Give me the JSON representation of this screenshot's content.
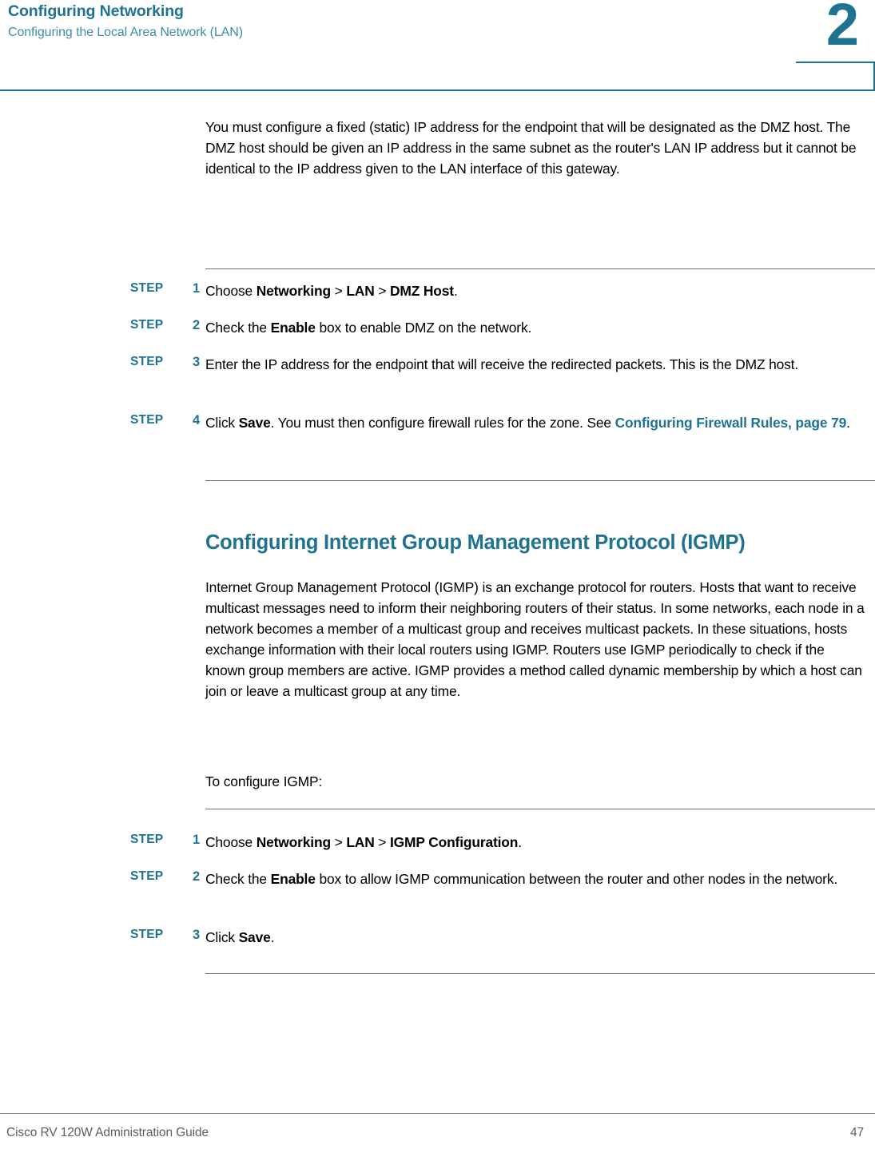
{
  "header": {
    "title": "Configuring Networking",
    "subtitle": "Configuring the Local Area Network (LAN)",
    "chapter_number": "2",
    "rule_color": "#1f7391"
  },
  "colors": {
    "accent_teal": "#1f7391",
    "subtitle_teal": "#3d8fa8",
    "body_black": "#000000",
    "rule_gray": "#6e6e6e",
    "footer_gray": "#5e5e5e"
  },
  "intro_paragraph": "You must configure a fixed (static) IP address for the endpoint that will be designated as the DMZ host. The DMZ host should be given an IP address in the same subnet as the router's LAN IP address but it cannot be identical to the IP address given to the LAN interface of this gateway.",
  "dmz_steps": {
    "label_text": "STEP",
    "items": [
      {
        "number": "1",
        "parts": [
          {
            "text": "Choose ",
            "style": "normal"
          },
          {
            "text": "Networking",
            "style": "bold"
          },
          {
            "text": " > ",
            "style": "normal"
          },
          {
            "text": "LAN",
            "style": "bold"
          },
          {
            "text": " > ",
            "style": "normal"
          },
          {
            "text": "DMZ Host",
            "style": "bold"
          },
          {
            "text": ".",
            "style": "normal"
          }
        ]
      },
      {
        "number": "2",
        "parts": [
          {
            "text": "Check the ",
            "style": "normal"
          },
          {
            "text": "Enable",
            "style": "bold"
          },
          {
            "text": " box to enable DMZ on the network.",
            "style": "normal"
          }
        ]
      },
      {
        "number": "3",
        "parts": [
          {
            "text": "Enter the IP address for the endpoint that will receive the redirected packets. This is the DMZ host.",
            "style": "normal"
          }
        ]
      },
      {
        "number": "4",
        "parts": [
          {
            "text": "Click ",
            "style": "normal"
          },
          {
            "text": "Save",
            "style": "bold"
          },
          {
            "text": ". You must then configure firewall rules for the zone. See ",
            "style": "normal"
          },
          {
            "text": "Configuring Firewall Rules, page 79",
            "style": "xref"
          },
          {
            "text": ".",
            "style": "normal"
          }
        ]
      }
    ]
  },
  "igmp_section": {
    "heading": "Configuring Internet Group Management Protocol (IGMP)",
    "paragraph": "Internet Group Management Protocol (IGMP) is an exchange protocol for routers. Hosts that want to receive multicast messages need to inform their neighboring routers of their status. In some networks, each node in a network becomes a member of a multicast group and receives multicast packets. In these situations, hosts exchange information with their local routers using IGMP. Routers use IGMP periodically to check if the known group members are active. IGMP provides a method called dynamic membership by which a host can join or leave a multicast group at any time.",
    "lead_in": "To configure IGMP:"
  },
  "igmp_steps": {
    "label_text": "STEP",
    "items": [
      {
        "number": "1",
        "parts": [
          {
            "text": "Choose ",
            "style": "normal"
          },
          {
            "text": "Networking",
            "style": "bold"
          },
          {
            "text": " > ",
            "style": "normal"
          },
          {
            "text": "LAN",
            "style": "bold"
          },
          {
            "text": " > ",
            "style": "normal"
          },
          {
            "text": "IGMP Configuration",
            "style": "bold"
          },
          {
            "text": ".",
            "style": "normal"
          }
        ]
      },
      {
        "number": "2",
        "parts": [
          {
            "text": "Check the ",
            "style": "normal"
          },
          {
            "text": "Enable",
            "style": "bold"
          },
          {
            "text": " box to allow IGMP communication between the router and other nodes in the network.",
            "style": "normal"
          }
        ]
      },
      {
        "number": "3",
        "parts": [
          {
            "text": "Click ",
            "style": "normal"
          },
          {
            "text": "Save",
            "style": "bold"
          },
          {
            "text": ".",
            "style": "normal"
          }
        ]
      }
    ]
  },
  "footer": {
    "guide_title": "Cisco RV 120W Administration Guide",
    "page_number": "47"
  }
}
